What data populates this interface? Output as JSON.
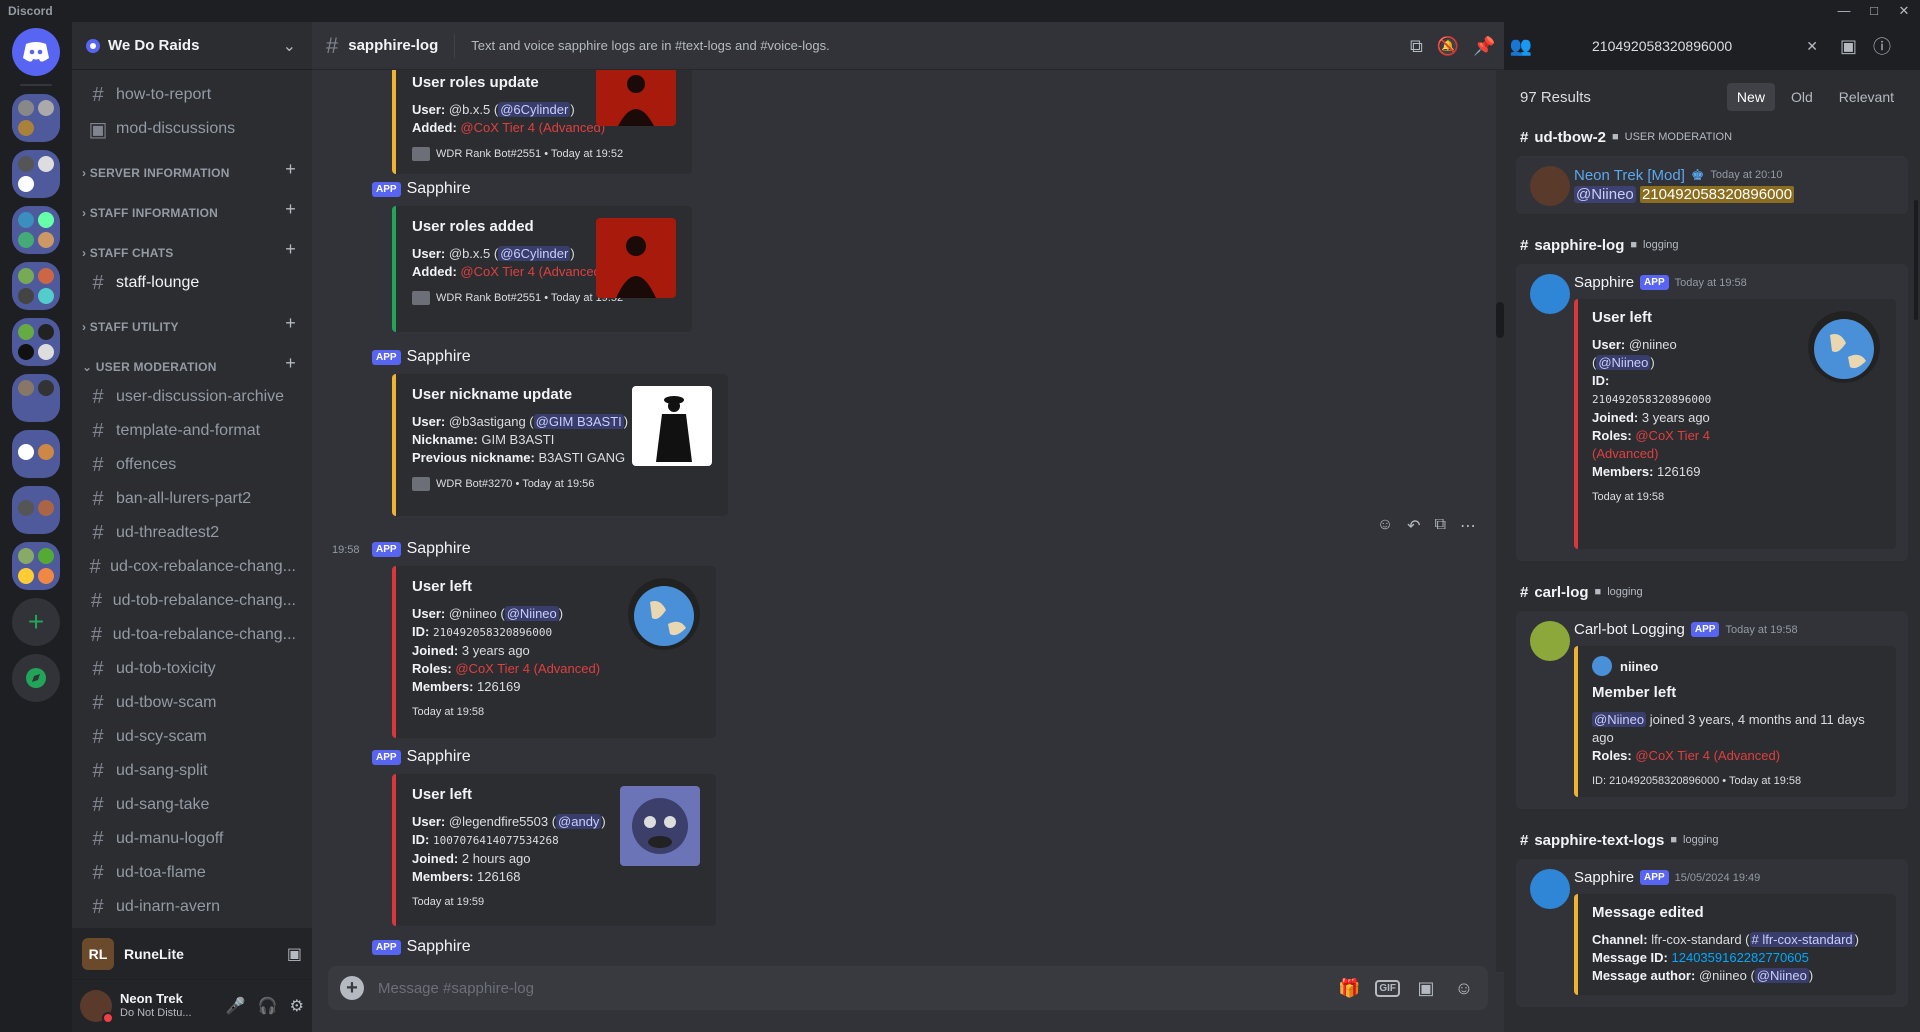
{
  "window": {
    "title": "Discord"
  },
  "server": {
    "name": "We Do Raids"
  },
  "channels": {
    "top": [
      {
        "label": "how-to-report",
        "type": "text"
      },
      {
        "label": "mod-discussions",
        "type": "forum"
      }
    ],
    "categories": [
      {
        "label": "SERVER INFORMATION"
      },
      {
        "label": "STAFF INFORMATION"
      },
      {
        "label": "STAFF CHATS"
      },
      {
        "label": "STAFF UTILITY"
      },
      {
        "label": "USER MODERATION"
      }
    ],
    "staff_chats": [
      {
        "label": "staff-lounge"
      }
    ],
    "user_moderation": [
      {
        "label": "user-discussion-archive"
      },
      {
        "label": "template-and-format"
      },
      {
        "label": "offences"
      },
      {
        "label": "ban-all-lurers-part2"
      },
      {
        "label": "ud-threadtest2"
      },
      {
        "label": "ud-cox-rebalance-chang..."
      },
      {
        "label": "ud-tob-rebalance-chang..."
      },
      {
        "label": "ud-toa-rebalance-chang..."
      },
      {
        "label": "ud-tob-toxicity"
      },
      {
        "label": "ud-tbow-scam"
      },
      {
        "label": "ud-scy-scam"
      },
      {
        "label": "ud-sang-split"
      },
      {
        "label": "ud-sang-take"
      },
      {
        "label": "ud-manu-logoff"
      },
      {
        "label": "ud-toa-flame"
      },
      {
        "label": "ud-inarn-avern"
      }
    ]
  },
  "voice_bar": {
    "logo": "RL",
    "name": "RuneLite"
  },
  "user_bar": {
    "name": "Neon Trek",
    "status": "Do Not Distu..."
  },
  "channel": {
    "name": "sapphire-log",
    "topic": "Text and voice sapphire logs are in #text-logs and #voice-logs."
  },
  "search": {
    "value": "210492058320896000"
  },
  "messages": [
    {
      "title": "User roles update",
      "user_label": "User:",
      "user": "@b.x.5 (",
      "user_mention": "@6Cylinder",
      "user_close": ")",
      "added_label": "Added:",
      "added": "@CoX Tier 4 (Advanced)",
      "footer": "WDR Rank Bot#2551 • Today at 19:52"
    },
    {
      "app": "APP",
      "author": "Sapphire",
      "title": "User roles added",
      "user_label": "User:",
      "user": "@b.x.5 (",
      "user_mention": "@6Cylinder",
      "user_close": ")",
      "added_label": "Added:",
      "added": "@CoX Tier 4 (Advanced)",
      "footer": "WDR Rank Bot#2551 • Today at 19:52"
    },
    {
      "app": "APP",
      "author": "Sapphire",
      "title": "User nickname update",
      "user_label": "User:",
      "user": "@b3astigang (",
      "user_mention": "@GIM B3ASTI",
      "user_close": ")",
      "nick_label": "Nickname:",
      "nick": "GIM B3ASTI",
      "prev_label": "Previous nickname:",
      "prev": "B3ASTI GANG",
      "footer": "WDR Bot#3270 • Today at 19:56"
    },
    {
      "time": "19:58",
      "app": "APP",
      "author": "Sapphire",
      "title": "User left",
      "user_label": "User:",
      "user": "@niineo (",
      "user_mention": "@Niineo",
      "user_close": ")",
      "id_label": "ID:",
      "id": "210492058320896000",
      "joined_label": "Joined:",
      "joined": "3 years ago",
      "roles_label": "Roles:",
      "roles": "@CoX Tier 4 (Advanced)",
      "members_label": "Members:",
      "members": "126169",
      "footer": "Today at 19:58"
    },
    {
      "app": "APP",
      "author": "Sapphire",
      "title": "User left",
      "user_label": "User:",
      "user": "@legendfire5503 (",
      "user_mention": "@andy",
      "user_close": ")",
      "id_label": "ID:",
      "id": "1007076414077534268",
      "joined_label": "Joined:",
      "joined": "2 hours ago",
      "members_label": "Members:",
      "members": "126168",
      "footer": "Today at 19:59"
    },
    {
      "app": "APP",
      "author": "Sapphire"
    }
  ],
  "composer": {
    "placeholder": "Message #sapphire-log",
    "gif": "GIF"
  },
  "results": {
    "count": "97 Results",
    "tabs": [
      "New",
      "Old",
      "Relevant"
    ],
    "items": [
      {
        "channel": "ud-tbow-2",
        "category": "USER MODERATION",
        "author": "Neon Trek [Mod]",
        "time": "Today at 20:10",
        "mention": "@Niineo",
        "highlight": "210492058320896000"
      },
      {
        "channel": "sapphire-log",
        "category": "logging",
        "author": "Sapphire",
        "app": "APP",
        "time": "Today at 19:58",
        "title": "User left",
        "user_label": "User:",
        "user": "@niineo",
        "user_mention": "@Niineo",
        "id_label": "ID:",
        "id": "210492058320896000",
        "joined_label": "Joined:",
        "joined": "3 years ago",
        "roles_label": "Roles:",
        "roles": "@CoX Tier 4 (Advanced)",
        "members_label": "Members:",
        "members": "126169",
        "footer": "Today at 19:58"
      },
      {
        "channel": "carl-log",
        "category": "logging",
        "author": "Carl-bot Logging",
        "app": "APP",
        "time": "Today at 19:58",
        "embed_author": "niineo",
        "title": "Member left",
        "mention": "@Niineo",
        "text": "joined 3 years, 4 months and 11 days ago",
        "roles_label": "Roles:",
        "roles": "@CoX Tier 4 (Advanced)",
        "footer": "ID: 210492058320896000 • Today at 19:58"
      },
      {
        "channel": "sapphire-text-logs",
        "category": "logging",
        "author": "Sapphire",
        "app": "APP",
        "time": "15/05/2024 19:49",
        "title": "Message edited",
        "channel_label": "Channel:",
        "channel_val": "lfr-cox-standard (",
        "channel_mention": "# lfr-cox-standard",
        "channel_close": ")",
        "msgid_label": "Message ID:",
        "msgid": "1240359162282770605",
        "author_label": "Message author:",
        "author_val": "@niineo (",
        "author_mention": "@Niineo",
        "author_close": ")"
      }
    ]
  },
  "colors": {
    "accent": "#5865f2",
    "red_role": "#e03f3f",
    "embed_yellow": "#f0b232",
    "embed_red": "#da373c",
    "embed_green": "#23a559"
  }
}
